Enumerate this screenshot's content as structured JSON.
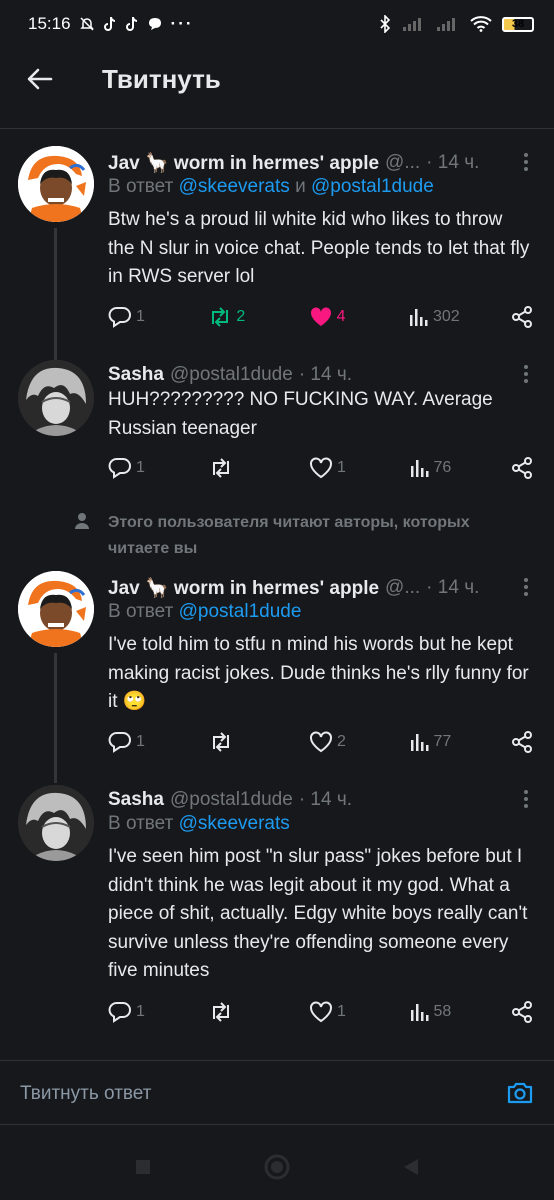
{
  "status_bar": {
    "time": "15:16",
    "battery": "38"
  },
  "header": {
    "title": "Твитнуть"
  },
  "tweets": [
    {
      "name": "Jav 🦙 worm in hermes' apple",
      "handle": "@...",
      "time": "· 14 ч.",
      "reply_prefix": "В ответ",
      "reply_to_1": "@skeeverats",
      "reply_and": "и",
      "reply_to_2": "@postal1dude",
      "text": "Btw he's a proud lil white kid who likes to throw the N slur in voice chat. People tends to let that fly in RWS server lol",
      "replies": "1",
      "retweets": "2",
      "likes": "4",
      "views": "302"
    },
    {
      "name": "Sasha",
      "handle": "@postal1dude",
      "time": "· 14 ч.",
      "text": "HUH????????? NO FUCKING WAY. Average Russian teenager",
      "replies": "1",
      "retweets": "",
      "likes": "1",
      "views": "76"
    },
    {
      "name": "Jav 🦙 worm in hermes' apple",
      "handle": "@...",
      "time": "· 14 ч.",
      "reply_prefix": "В ответ",
      "reply_to_1": "@postal1dude",
      "text": "I've told him to stfu n mind his words but he kept making racist jokes. Dude thinks he's rlly funny for it 🙄",
      "replies": "1",
      "retweets": "",
      "likes": "2",
      "views": "77"
    },
    {
      "name": "Sasha",
      "handle": "@postal1dude",
      "time": "· 14 ч.",
      "reply_prefix": "В ответ",
      "reply_to_1": "@skeeverats",
      "text": "I've seen him post \"n slur pass\" jokes before but I didn't think he was legit about it my god. What a piece of shit, actually. Edgy white boys really can't survive unless they're offending someone every five minutes",
      "replies": "1",
      "retweets": "",
      "likes": "1",
      "views": "58"
    }
  ],
  "social_context": "Этого пользователя читают авторы, которых читаете вы",
  "compose": {
    "placeholder": "Твитнуть ответ"
  },
  "icons": {
    "back": "arrow-left-icon",
    "more": "more-vertical-icon",
    "reply": "reply-icon",
    "retweet": "retweet-icon",
    "like": "heart-icon",
    "views": "views-icon",
    "share": "share-icon",
    "camera": "camera-icon",
    "person": "person-icon"
  },
  "colors": {
    "link": "#1d9bf0",
    "retweet_active": "#00ba7c",
    "like_active": "#f91880",
    "background": "#16181c"
  }
}
